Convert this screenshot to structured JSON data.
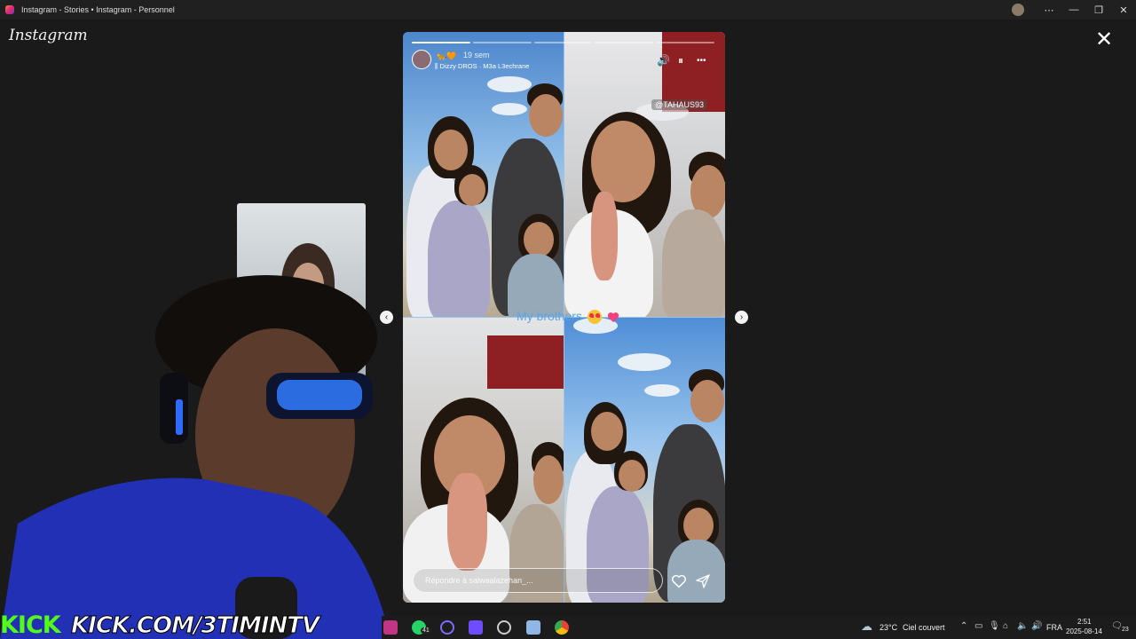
{
  "window": {
    "title": "Instagram - Stories • Instagram - Personnel",
    "controls": [
      "⋯",
      "—",
      "❐",
      "✕"
    ]
  },
  "app": {
    "logo_text": "Instagram",
    "close_glyph": "✕"
  },
  "story": {
    "username": "🐆🧡",
    "time_ago": "19 sem",
    "music": "Dizzy DROS · M3a L3echrane",
    "mention_tag": "@TAHAUS93",
    "caption_text": "My brothers",
    "progress_segments": 5,
    "progress_active_index": 0,
    "reply_placeholder": "Répondre à salwaalazehan_...",
    "controls": {
      "sound": "🔊",
      "pause": "⏸",
      "more": "•••"
    }
  },
  "navigation": {
    "prev": "‹",
    "next": "›"
  },
  "stream_overlay": {
    "platform_logo": "KICK",
    "url": "KICK.COM/3TIMINTV",
    "brand_color": "#53fc18"
  },
  "taskbar": {
    "weather_temp": "23°C",
    "weather_text": "Ciel couvert",
    "language": "FRA",
    "time": "2:51",
    "date": "2025-08-14",
    "notification_count": "23",
    "whatsapp_badge": "41"
  }
}
